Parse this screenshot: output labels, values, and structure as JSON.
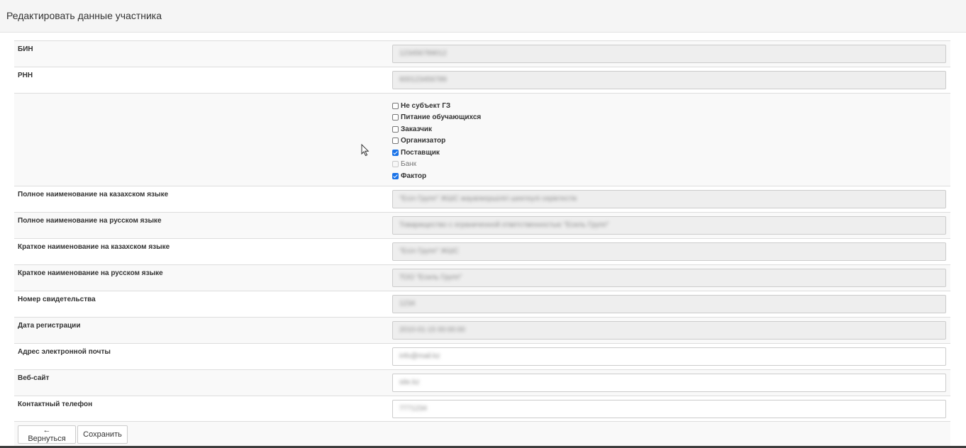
{
  "header": {
    "title": "Редактировать данные участника"
  },
  "fields": [
    {
      "label": "БИН",
      "value": "123456789012",
      "editable": false
    },
    {
      "label": "РНН",
      "value": "600123456789",
      "editable": false
    }
  ],
  "checkboxes": [
    {
      "label": "Не субъект ГЗ",
      "checked": false,
      "disabled": false
    },
    {
      "label": "Питание обучающихся",
      "checked": false,
      "disabled": false
    },
    {
      "label": "Заказчик",
      "checked": false,
      "disabled": false
    },
    {
      "label": "Организатор",
      "checked": false,
      "disabled": false
    },
    {
      "label": "Поставщик",
      "checked": true,
      "disabled": false
    },
    {
      "label": "Банк",
      "checked": false,
      "disabled": true
    },
    {
      "label": "Фактор",
      "checked": true,
      "disabled": false
    }
  ],
  "fields2": [
    {
      "label": "Полное наименование на казахском языке",
      "value": "\"Есіл Групп\" ЖШС жауапкершілігі шектеулі серіктестік",
      "editable": false
    },
    {
      "label": "Полное наименование на русском языке",
      "value": "Товарищество с ограниченной ответственностью \"Есиль Групп\"",
      "editable": false
    },
    {
      "label": "Краткое наименование на казахском языке",
      "value": "\"Есіл Групп\" ЖШС",
      "editable": false
    },
    {
      "label": "Краткое наименование на русском языке",
      "value": "ТОО \"Есиль Групп\"",
      "editable": false
    },
    {
      "label": "Номер свидетельства",
      "value": "1234",
      "editable": false
    },
    {
      "label": "Дата регистрации",
      "value": "2010-01-15 00:00:00",
      "editable": false
    },
    {
      "label": "Адрес электронной почты",
      "value": "info@mail.kz",
      "editable": true
    },
    {
      "label": "Веб-сайт",
      "value": "site.kz",
      "editable": true
    },
    {
      "label": "Контактный телефон",
      "value": "7771234",
      "editable": true
    }
  ],
  "actions": {
    "back_label": "← Вернуться",
    "save_label": "Сохранить"
  }
}
